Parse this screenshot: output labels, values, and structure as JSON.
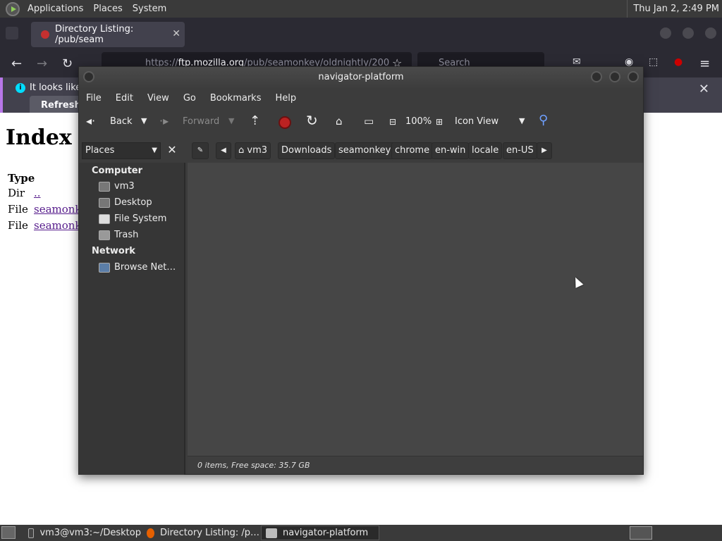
{
  "top_panel": {
    "menus": [
      "Applications",
      "Places",
      "System"
    ],
    "clock": "Thu Jan  2,  2:49 PM"
  },
  "browser": {
    "tab_title": "Directory Listing: /pub/seam",
    "url_host": "ftp.mozilla.org",
    "url_pre": "https://",
    "url_path": "/pub/seamonkey/oldnightly/200",
    "search_placeholder": "Search",
    "info_text": "It looks like",
    "refresh_label": "Refresh F",
    "page_heading": "Index o",
    "table_header": "Type",
    "rows": [
      {
        "type": "Dir",
        "name": ".."
      },
      {
        "type": "File",
        "name": "seamonke"
      },
      {
        "type": "File",
        "name": "seamonke"
      }
    ]
  },
  "file_manager": {
    "title": "navigator-platform",
    "menu": [
      "File",
      "Edit",
      "View",
      "Go",
      "Bookmarks",
      "Help"
    ],
    "toolbar": {
      "back": "Back",
      "forward": "Forward",
      "zoom": "100%",
      "view_mode": "Icon View"
    },
    "places_label": "Places",
    "breadcrumbs": [
      "vm3",
      "Downloads",
      "seamonkey",
      "chrome",
      "en-win",
      "locale",
      "en-US"
    ],
    "sidebar": {
      "computer_header": "Computer",
      "computer_items": [
        "vm3",
        "Desktop",
        "File System",
        "Trash"
      ],
      "network_header": "Network",
      "network_items": [
        "Browse Net…"
      ]
    },
    "status": "0 items, Free space: 35.7 GB"
  },
  "taskbar": {
    "tasks": [
      "vm3@vm3:~/Desktop",
      "Directory Listing: /p…",
      "navigator-platform"
    ]
  },
  "colors": {
    "panel_bg": "#3a3a3a",
    "window_bg": "#3c3c3c",
    "content_bg": "#464646",
    "browser_chrome": "#2b2a33",
    "link": "#551a8b"
  }
}
